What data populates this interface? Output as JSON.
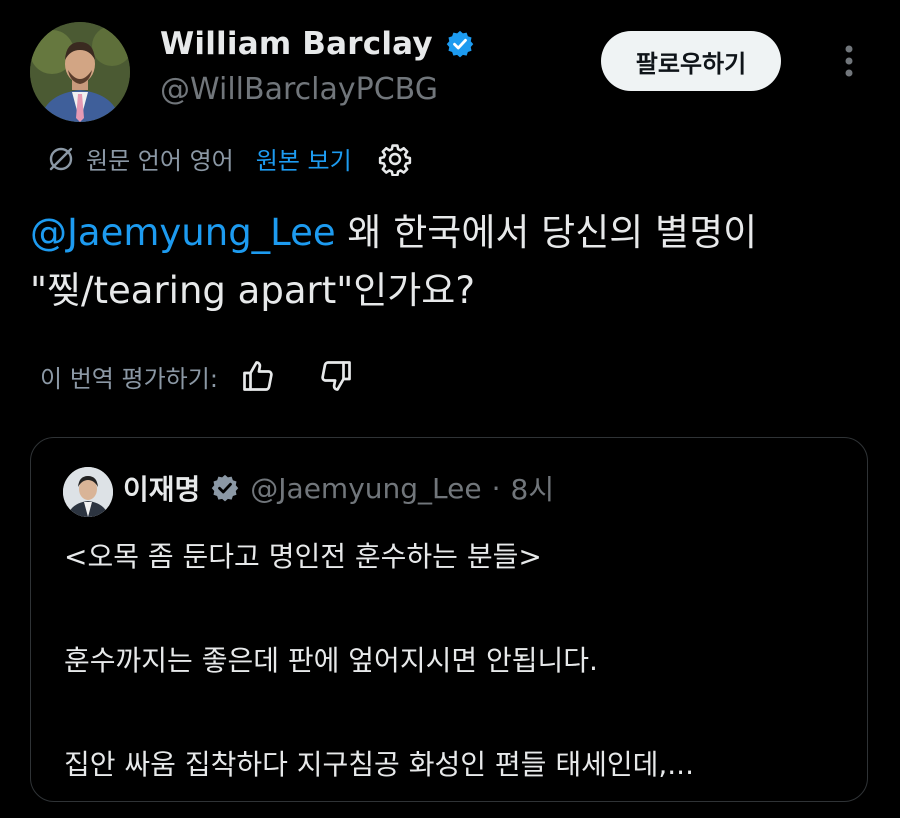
{
  "author": {
    "name": "William Barclay",
    "handle": "@WillBarclayPCBG"
  },
  "actions": {
    "follow_label": "팔로우하기"
  },
  "translation": {
    "source_language": "원문 언어 영어",
    "show_original_label": "원본 보기"
  },
  "tweet": {
    "mention": "@Jaemyung_Lee",
    "text_line1": " 왜 한국에서 당신의 별명이",
    "text_line2": "\"찢/tearing apart\"인가요?"
  },
  "rating": {
    "label": "이 번역 평가하기:"
  },
  "quote": {
    "name": "이재명",
    "handle": "@Jaemyung_Lee",
    "separator": "·",
    "time": "8시",
    "lines": [
      "<오목 좀 둔다고 명인전 훈수하는 분들>",
      "훈수까지는 좋은데 판에 엎어지시면 안됩니다.",
      "집안 싸움 집착하다 지구침공 화성인 편들 태세인데,..."
    ]
  },
  "colors": {
    "background": "#000000",
    "text_primary": "#e7e9ea",
    "text_secondary": "#71767b",
    "accent": "#1d9bf0",
    "border": "#2f3336",
    "follow_bg": "#eff3f4"
  },
  "icons": [
    "verified-badge-icon",
    "more-options-icon",
    "translate-icon",
    "gear-icon",
    "thumbs-up-icon",
    "thumbs-down-icon"
  ]
}
